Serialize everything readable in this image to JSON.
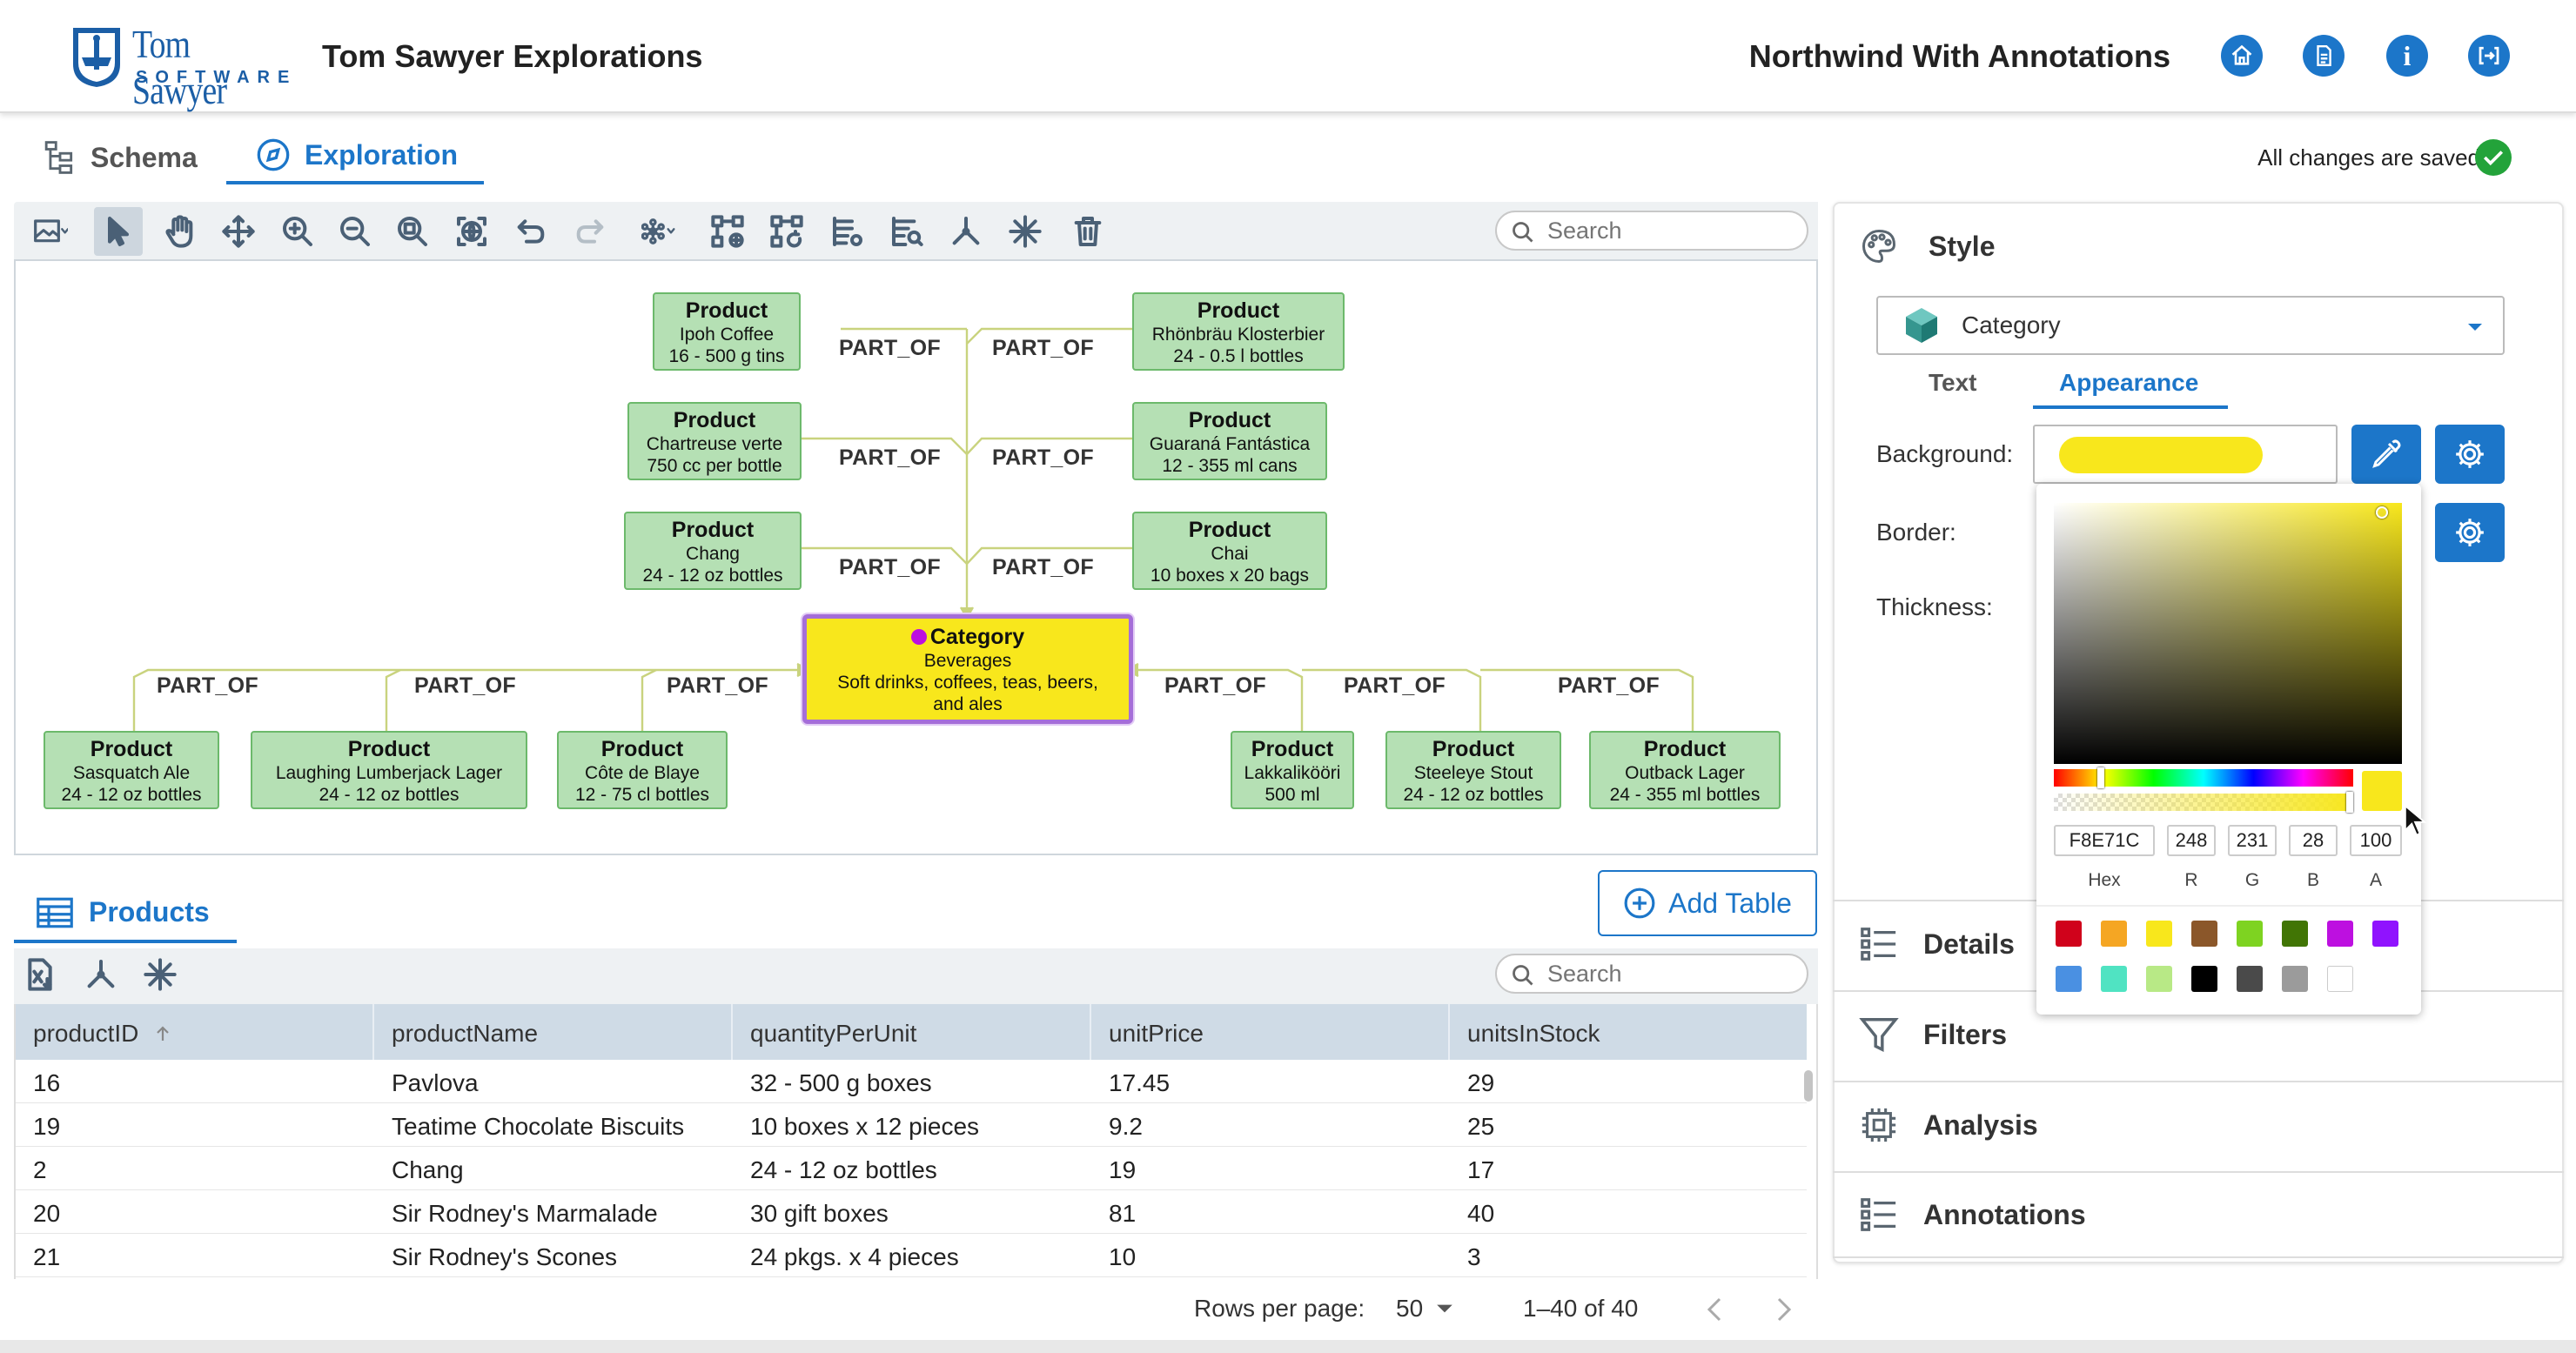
{
  "header": {
    "logo_top": "Tom Sawyer",
    "logo_bottom": "SOFTWARE",
    "app_title": "Tom Sawyer Explorations",
    "project_name": "Northwind With Annotations",
    "icons": [
      "home-icon",
      "document-icon",
      "info-icon",
      "logout-icon"
    ]
  },
  "tabs": [
    {
      "label": "Schema",
      "active": false
    },
    {
      "label": "Exploration",
      "active": true
    }
  ],
  "save_status": "All changes are saved",
  "graph_search_placeholder": "Search",
  "graph": {
    "top_products": [
      {
        "title": "Product",
        "name": "Ipoh Coffee",
        "qty": "16 - 500 g tins"
      },
      {
        "title": "Product",
        "name": "Rhönbräu Klosterbier",
        "qty": "24 - 0.5 l bottles"
      },
      {
        "title": "Product",
        "name": "Chartreuse verte",
        "qty": "750 cc per bottle"
      },
      {
        "title": "Product",
        "name": "Guaraná Fantástica",
        "qty": "12 - 355 ml cans"
      },
      {
        "title": "Product",
        "name": "Chang",
        "qty": "24 - 12 oz bottles"
      },
      {
        "title": "Product",
        "name": "Chai",
        "qty": "10 boxes x 20 bags"
      }
    ],
    "bottom_products": [
      {
        "title": "Product",
        "name": "Sasquatch Ale",
        "qty": "24 - 12 oz bottles"
      },
      {
        "title": "Product",
        "name": "Laughing Lumberjack Lager",
        "qty": "24 - 12 oz bottles"
      },
      {
        "title": "Product",
        "name": "Côte de Blaye",
        "qty": "12 - 75 cl bottles"
      },
      {
        "title": "Product",
        "name": "Lakkalikööri",
        "qty": "500 ml"
      },
      {
        "title": "Product",
        "name": "Steeleye Stout",
        "qty": "24 - 12 oz bottles"
      },
      {
        "title": "Product",
        "name": "Outback Lager",
        "qty": "24 - 355 ml bottles"
      }
    ],
    "category": {
      "title": "Category",
      "name": "Beverages",
      "description": "Soft drinks, coffees, teas, beers, and ales"
    },
    "edge_label": "PART_OF"
  },
  "products_table": {
    "tab_label": "Products",
    "add_table_label": "Add Table",
    "search_placeholder": "Search",
    "columns": [
      "productID",
      "productName",
      "quantityPerUnit",
      "unitPrice",
      "unitsInStock"
    ],
    "rows": [
      [
        "16",
        "Pavlova",
        "32 - 500 g boxes",
        "17.45",
        "29"
      ],
      [
        "19",
        "Teatime Chocolate Biscuits",
        "10 boxes x 12 pieces",
        "9.2",
        "25"
      ],
      [
        "2",
        "Chang",
        "24 - 12 oz bottles",
        "19",
        "17"
      ],
      [
        "20",
        "Sir Rodney's Marmalade",
        "30 gift boxes",
        "81",
        "40"
      ],
      [
        "21",
        "Sir Rodney's Scones",
        "24 pkgs. x 4 pieces",
        "10",
        "3"
      ]
    ],
    "rows_per_page_label": "Rows per page:",
    "rows_per_page": "50",
    "range": "1–40 of 40"
  },
  "style_panel": {
    "title": "Style",
    "selected_type": "Category",
    "subtabs": [
      {
        "label": "Text",
        "active": false
      },
      {
        "label": "Appearance",
        "active": true
      }
    ],
    "background_label": "Background:",
    "border_label": "Border:",
    "thickness_label": "Thickness:",
    "background_color": "#F8E71C"
  },
  "color_picker": {
    "hex": "F8E71C",
    "r": "248",
    "g": "231",
    "b": "28",
    "a": "100",
    "labels": [
      "Hex",
      "R",
      "G",
      "B",
      "A"
    ],
    "presets": [
      "#D0021B",
      "#F5A623",
      "#F8E71C",
      "#8B572A",
      "#7ED321",
      "#417505",
      "#BD10E0",
      "#9013FE",
      "#4A90E2",
      "#50E3C2",
      "#B8E986",
      "#000000",
      "#4A4A4A",
      "#9B9B9B",
      "#FFFFFF"
    ]
  },
  "accordion": [
    {
      "label": "Details",
      "icon": "list-icon"
    },
    {
      "label": "Filters",
      "icon": "filter-icon"
    },
    {
      "label": "Analysis",
      "icon": "chip-icon"
    },
    {
      "label": "Annotations",
      "icon": "list-icon"
    }
  ]
}
